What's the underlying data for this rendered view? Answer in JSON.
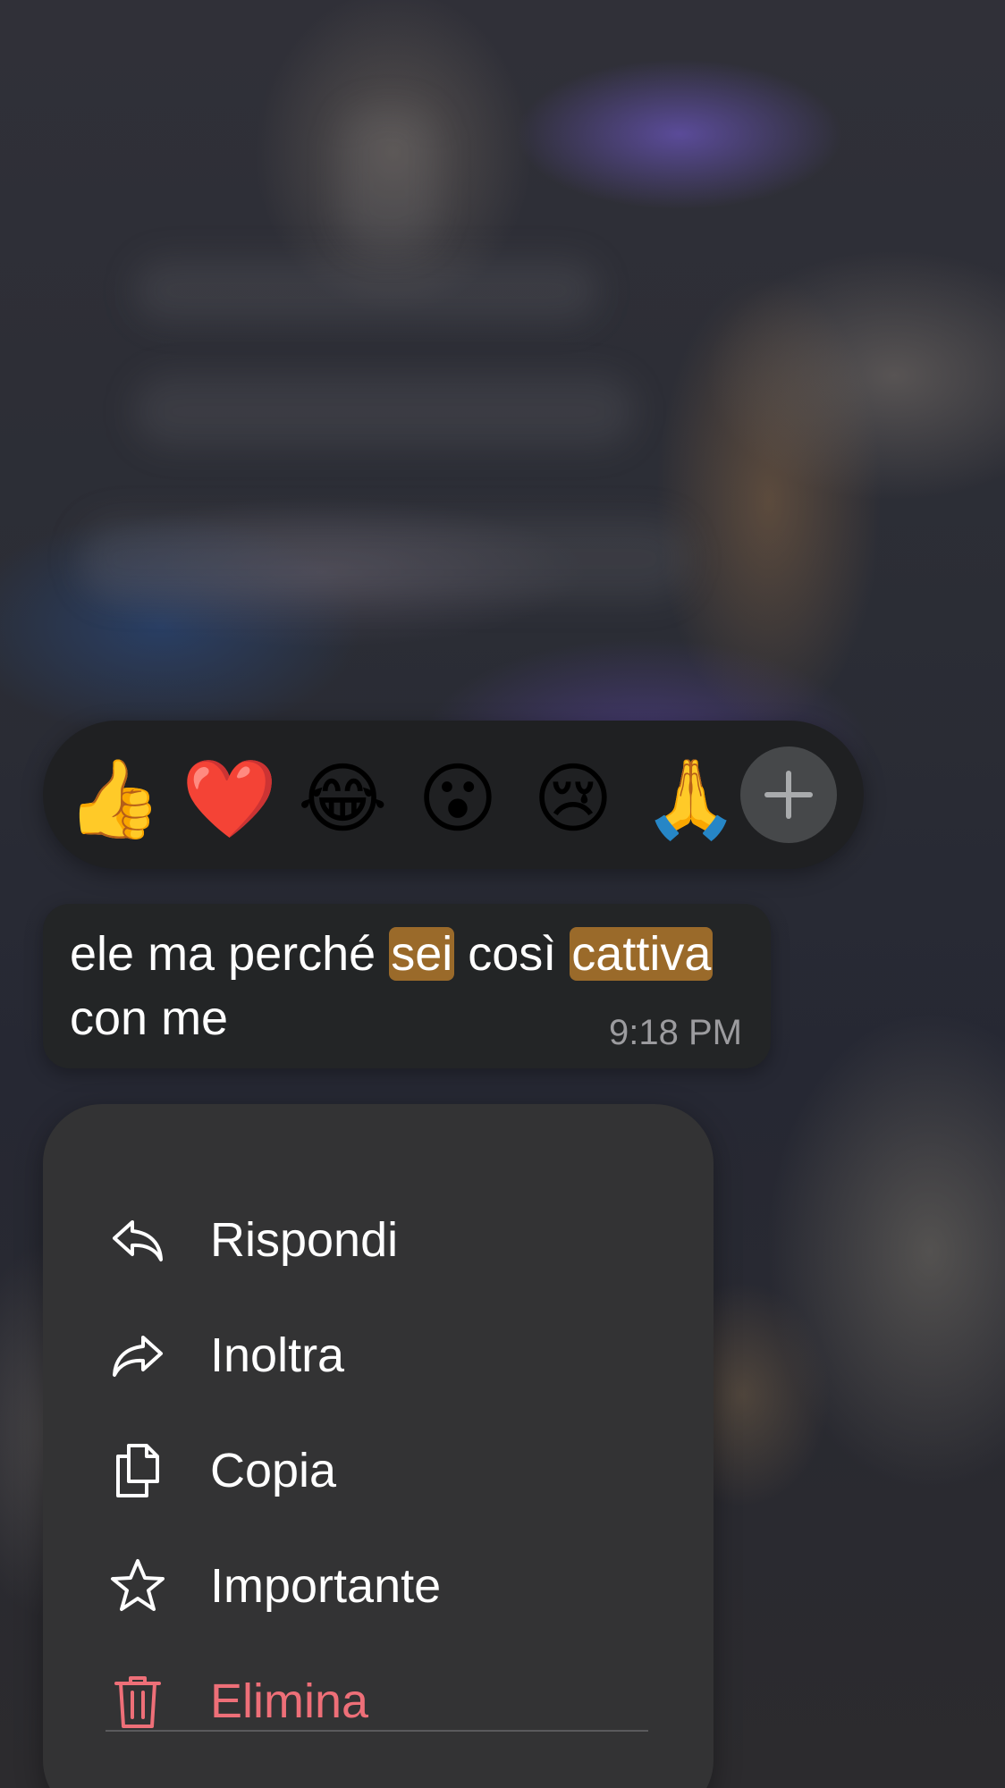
{
  "colors": {
    "reaction_bar_bg": "#1f2022",
    "bubble_bg": "#232526",
    "menu_bg": "#333334",
    "highlight": "#9a6a2a",
    "danger": "#ee6f78",
    "timestamp": "#9c9c9f"
  },
  "reactions": [
    {
      "emoji": "👍",
      "name": "thumbs-up"
    },
    {
      "emoji": "❤️",
      "name": "red-heart"
    },
    {
      "emoji": "😂",
      "name": "tears-of-joy"
    },
    {
      "emoji": "😮",
      "name": "open-mouth"
    },
    {
      "emoji": "😢",
      "name": "crying-face"
    },
    {
      "emoji": "🙏",
      "name": "folded-hands"
    }
  ],
  "reaction_more_icon": "plus-icon",
  "message": {
    "part1": "ele ma perché ",
    "highlight1": "sei",
    "part2": " così ",
    "highlight2": "cattiva",
    "part3": " con me",
    "time": "9:18 PM"
  },
  "menu": {
    "items": [
      {
        "label": "Rispondi",
        "icon": "reply-icon"
      },
      {
        "label": "Inoltra",
        "icon": "forward-icon"
      },
      {
        "label": "Copia",
        "icon": "copy-icon"
      },
      {
        "label": "Importante",
        "icon": "star-icon"
      },
      {
        "label": "Elimina",
        "icon": "trash-icon",
        "danger": true
      }
    ]
  }
}
